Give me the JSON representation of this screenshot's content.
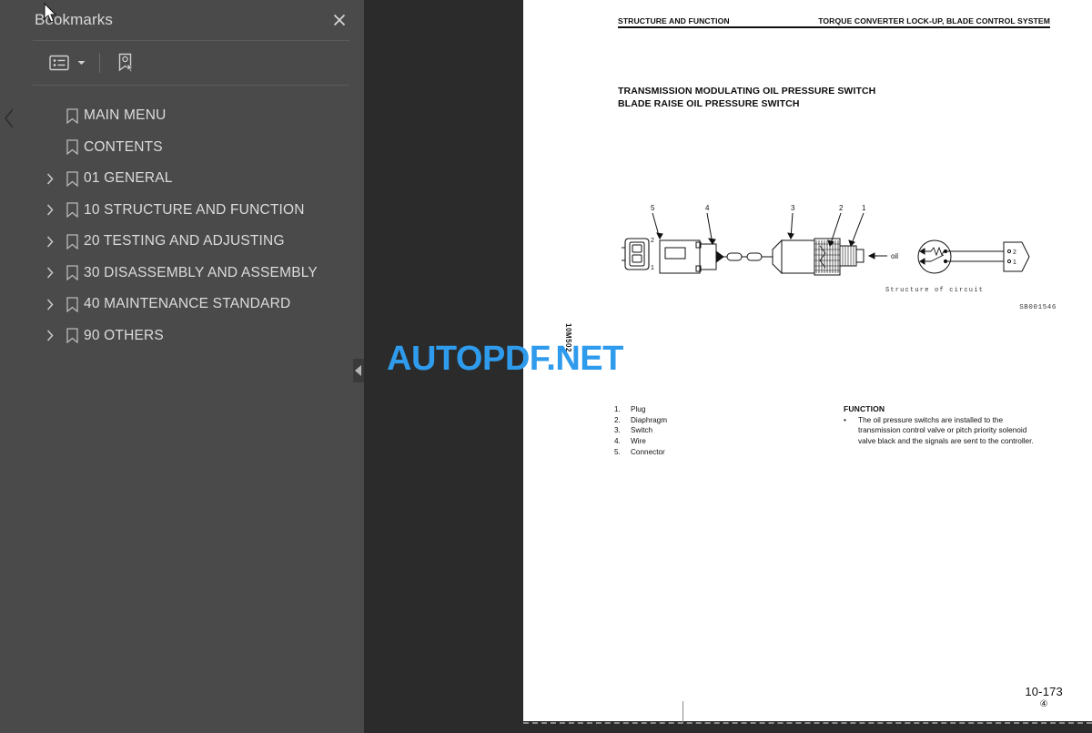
{
  "sidebar": {
    "title": "Bookmarks",
    "close_label": "×",
    "toolbar": {
      "list_options_label": "list-options",
      "caret_label": "▾",
      "find_bookmark_label": "find-current-bookmark"
    },
    "items": [
      {
        "label": "MAIN MENU",
        "expandable": false
      },
      {
        "label": "CONTENTS",
        "expandable": false
      },
      {
        "label": "01 GENERAL",
        "expandable": true
      },
      {
        "label": "10 STRUCTURE AND FUNCTION",
        "expandable": true
      },
      {
        "label": "20 TESTING AND ADJUSTING",
        "expandable": true
      },
      {
        "label": "30 DISASSEMBLY AND ASSEMBLY",
        "expandable": true
      },
      {
        "label": "40 MAINTENANCE STANDARD",
        "expandable": true
      },
      {
        "label": "90 OTHERS",
        "expandable": true
      }
    ]
  },
  "document": {
    "header_left": "STRUCTURE AND FUNCTION",
    "header_right": "TORQUE CONVERTER LOCK-UP, BLADE CONTROL SYSTEM",
    "title_line1": "TRANSMISSION MODULATING OIL PRESSURE SWITCH",
    "title_line2": "BLADE RAISE OIL PRESSURE SWITCH",
    "figure": {
      "callouts": [
        "5",
        "4",
        "3",
        "2",
        "1"
      ],
      "connector_pins": [
        "2",
        "1"
      ],
      "oil_label": "oil",
      "circuit_caption": "Structure of circuit",
      "circuit_pins": [
        "2",
        "1"
      ],
      "figure_id": "SB001546"
    },
    "parts": [
      {
        "num": "1.",
        "name": "Plug"
      },
      {
        "num": "2.",
        "name": "Diaphragm"
      },
      {
        "num": "3.",
        "name": "Switch"
      },
      {
        "num": "4.",
        "name": "Wire"
      },
      {
        "num": "5.",
        "name": "Connector"
      }
    ],
    "function": {
      "heading": "FUNCTION",
      "bullet": "•",
      "text": "The oil pressure switchs are installed to the transmission control valve or pitch priority solenoid valve black and the signals are sent to the controller."
    },
    "page_number": "10-173",
    "page_mark": "④",
    "side_code": "10M502"
  },
  "watermark": {
    "text": "AUTOPDF.NET",
    "color": "#2f9bed"
  },
  "colors": {
    "sidebar_bg": "#4a4a4a",
    "viewer_bg": "#2b2b2b",
    "page_bg": "#ffffff",
    "text": "#dcdcdc"
  }
}
